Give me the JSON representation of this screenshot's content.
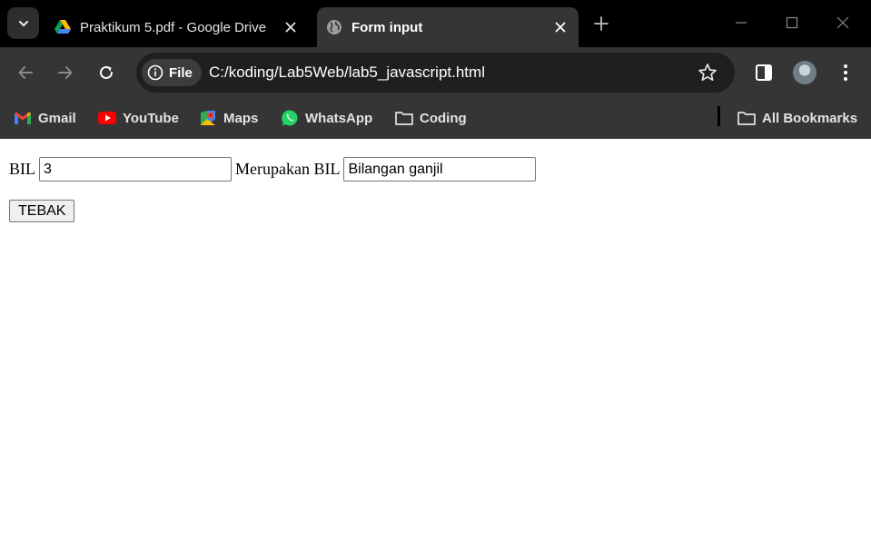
{
  "browser": {
    "tabs": [
      {
        "title": "Praktikum 5.pdf - Google Drive",
        "icon": "google-drive-icon",
        "active": false
      },
      {
        "title": "Form input",
        "icon": "globe-icon",
        "active": true
      }
    ],
    "address_bar": {
      "chip_label": "File",
      "url": "C:/koding/Lab5Web/lab5_javascript.html"
    },
    "bookmarks": [
      {
        "label": "Gmail",
        "icon": "gmail-icon"
      },
      {
        "label": "YouTube",
        "icon": "youtube-icon"
      },
      {
        "label": "Maps",
        "icon": "maps-icon"
      },
      {
        "label": "WhatsApp",
        "icon": "whatsapp-icon"
      },
      {
        "label": "Coding",
        "icon": "folder-icon"
      }
    ],
    "all_bookmarks": "All Bookmarks"
  },
  "page": {
    "label_bil": "BIL",
    "bil_value": "3",
    "label_result": "Merupakan BIL",
    "result_value": "Bilangan ganjil",
    "button_label": "TEBAK"
  },
  "colors": {
    "tabstrip": "#000000",
    "toolbar": "#353535",
    "omnibox": "#1f1f1f",
    "text": "#e3e3e3"
  }
}
